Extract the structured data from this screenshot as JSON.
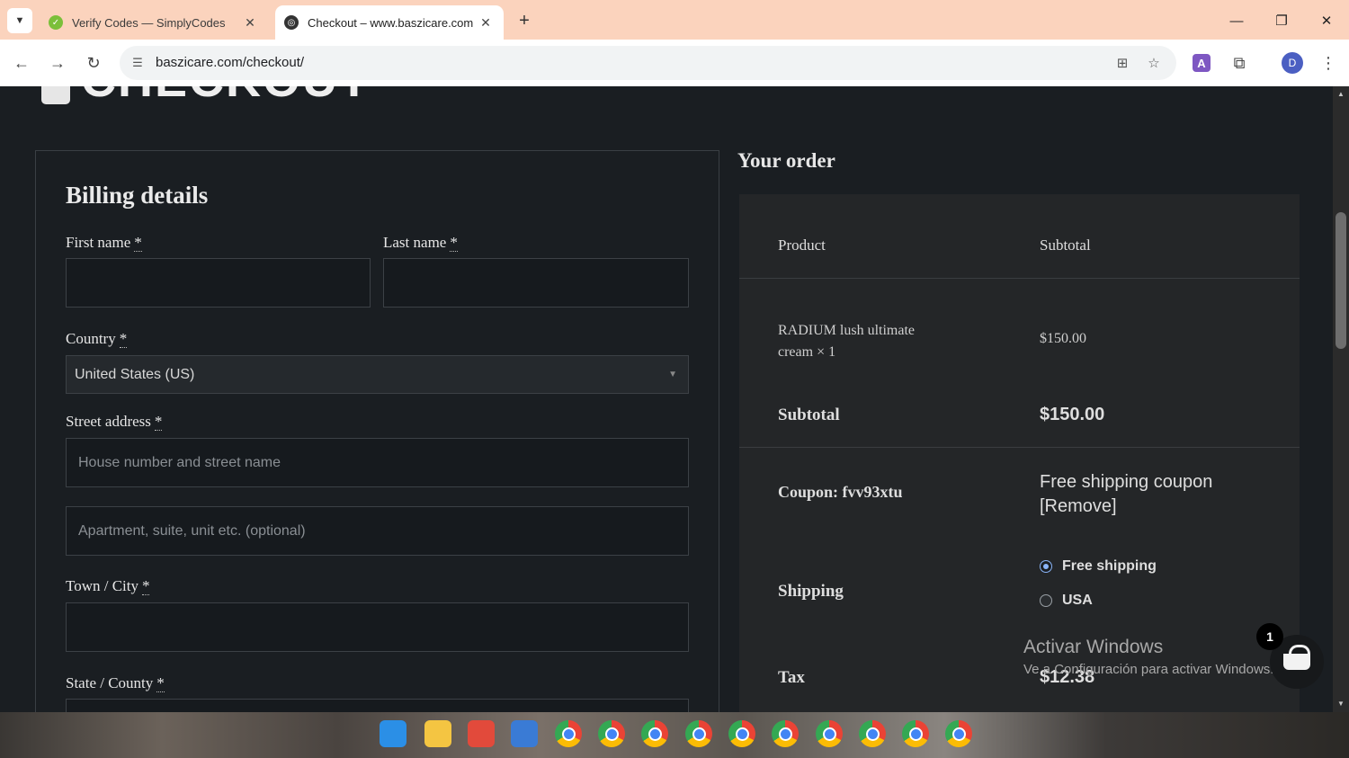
{
  "browser": {
    "tabs": [
      {
        "title": "Verify Codes — SimplyCodes",
        "active": false
      },
      {
        "title": "Checkout – www.baszicare.com",
        "active": true
      }
    ],
    "url": "baszicare.com/checkout/",
    "profile_initial": "D",
    "ext_letter": "A",
    "icons": {
      "tab_list": "chevron-down-icon",
      "back": "back-arrow-icon",
      "forward": "forward-arrow-icon",
      "reload": "reload-icon",
      "translate": "translate-icon",
      "bookmark": "star-icon",
      "extensions": "puzzle-icon",
      "menu": "kebab-menu-icon"
    }
  },
  "page": {
    "heading": "CHECKOUT",
    "billing": {
      "title": "Billing details",
      "required_mark": "*",
      "first_name_label": "First name",
      "last_name_label": "Last name",
      "country_label": "Country",
      "country_value": "United States (US)",
      "street_label": "Street address",
      "street_placeholder": "House number and street name",
      "apartment_placeholder": "Apartment, suite, unit etc. (optional)",
      "city_label": "Town / City",
      "state_label": "State / County"
    },
    "order": {
      "title": "Your order",
      "col_product": "Product",
      "col_subtotal": "Subtotal",
      "item_name_line1": "RADIUM lush ultimate",
      "item_name_line2": "cream",
      "item_qty": "× 1",
      "item_price": "$150.00",
      "subtotal_label": "Subtotal",
      "subtotal_value": "$150.00",
      "coupon_label": "Coupon: fvv93xtu",
      "coupon_value": "Free shipping coupon",
      "coupon_remove": "[Remove]",
      "shipping_label": "Shipping",
      "shipping_options": [
        {
          "label": "Free shipping",
          "selected": true
        },
        {
          "label": "USA",
          "selected": false
        }
      ],
      "tax_label": "Tax",
      "tax_value": "$12.38"
    },
    "cart_count": "1",
    "watermark_line1": "Activar Windows",
    "watermark_line2": "Ve a Configuración para activar Windows."
  },
  "colors": {
    "page_bg": "#1a1e22",
    "order_bg": "#242628",
    "tabbar_bg": "#fbd3bd",
    "radio_accent": "#8ab4f8"
  }
}
